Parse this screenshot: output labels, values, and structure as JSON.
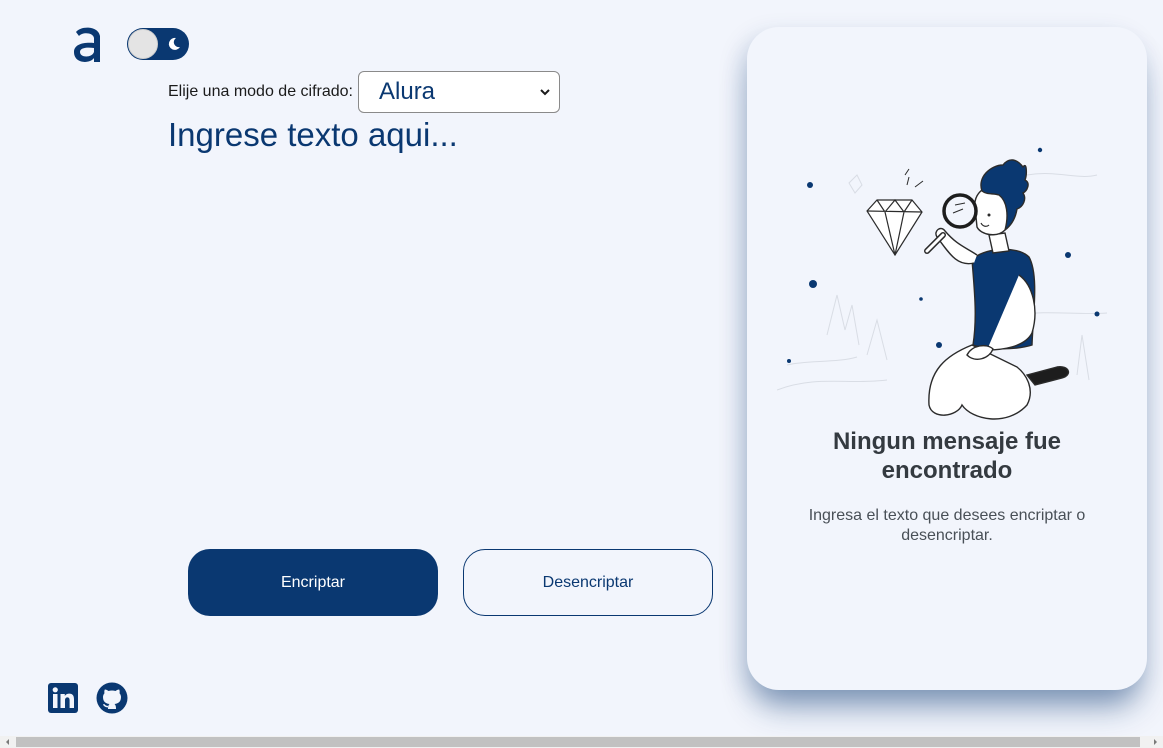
{
  "header": {
    "logo_icon": "alura-logo-icon",
    "theme_toggle_icon": "moon-icon"
  },
  "cipher": {
    "label": "Elije una modo de cifrado:",
    "selected": "Alura"
  },
  "input": {
    "placeholder": "Ingrese texto aqui..."
  },
  "actions": {
    "encrypt_label": "Encriptar",
    "decrypt_label": "Desencriptar"
  },
  "output_panel": {
    "title": "Ningun mensaje fue encontrado",
    "description": "Ingresa el texto que desees encriptar o desencriptar."
  },
  "footer": {
    "icons": [
      "linkedin-icon",
      "github-icon"
    ]
  },
  "colors": {
    "primary": "#0a3871",
    "background": "#f2f5fc",
    "title": "#343a40",
    "text": "#495057"
  }
}
